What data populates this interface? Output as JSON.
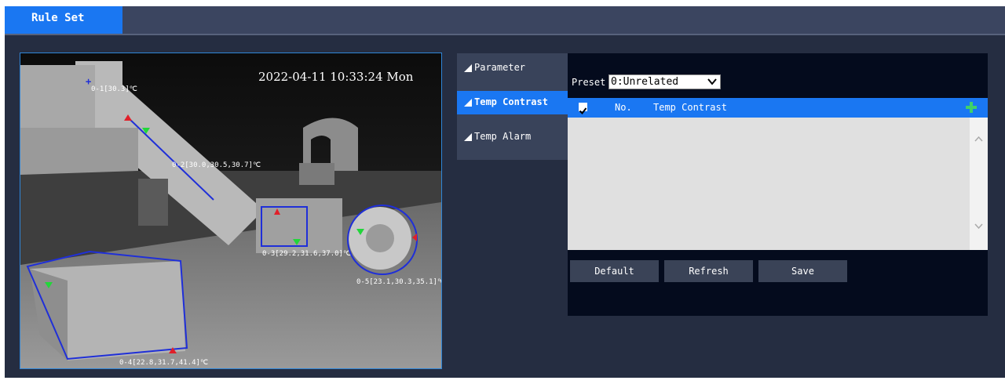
{
  "header": {
    "active_tab": "Rule Set"
  },
  "video": {
    "timestamp": "2022-04-11 10:33:24 Mon",
    "rule_labels": [
      "0-1[30.3]℃",
      "0-2[30.0,30.5,30.7]℃",
      "0-3[29.2,31.6,37.0]℃",
      "0-4[22.8,31.7,41.4]℃",
      "0-5[23.1,30.3,35.1]℃"
    ]
  },
  "menu": {
    "items": [
      {
        "label": "Parameter",
        "active": false
      },
      {
        "label": "Temp Contrast",
        "active": true
      },
      {
        "label": "Temp Alarm",
        "active": false
      }
    ]
  },
  "panel": {
    "preset_label": "Preset",
    "preset_value": "0:Unrelated",
    "table": {
      "columns": [
        "No.",
        "Temp Contrast"
      ],
      "rows": []
    },
    "buttons": {
      "default": "Default",
      "refresh": "Refresh",
      "save": "Save"
    }
  },
  "colors": {
    "accent": "#1a77f2",
    "background": "#252d41",
    "panel": "#040b1d",
    "rule_line": "#1f2fd8",
    "max_marker": "#e0202a",
    "min_marker": "#22d63a",
    "add_icon": "#3fd16b"
  }
}
